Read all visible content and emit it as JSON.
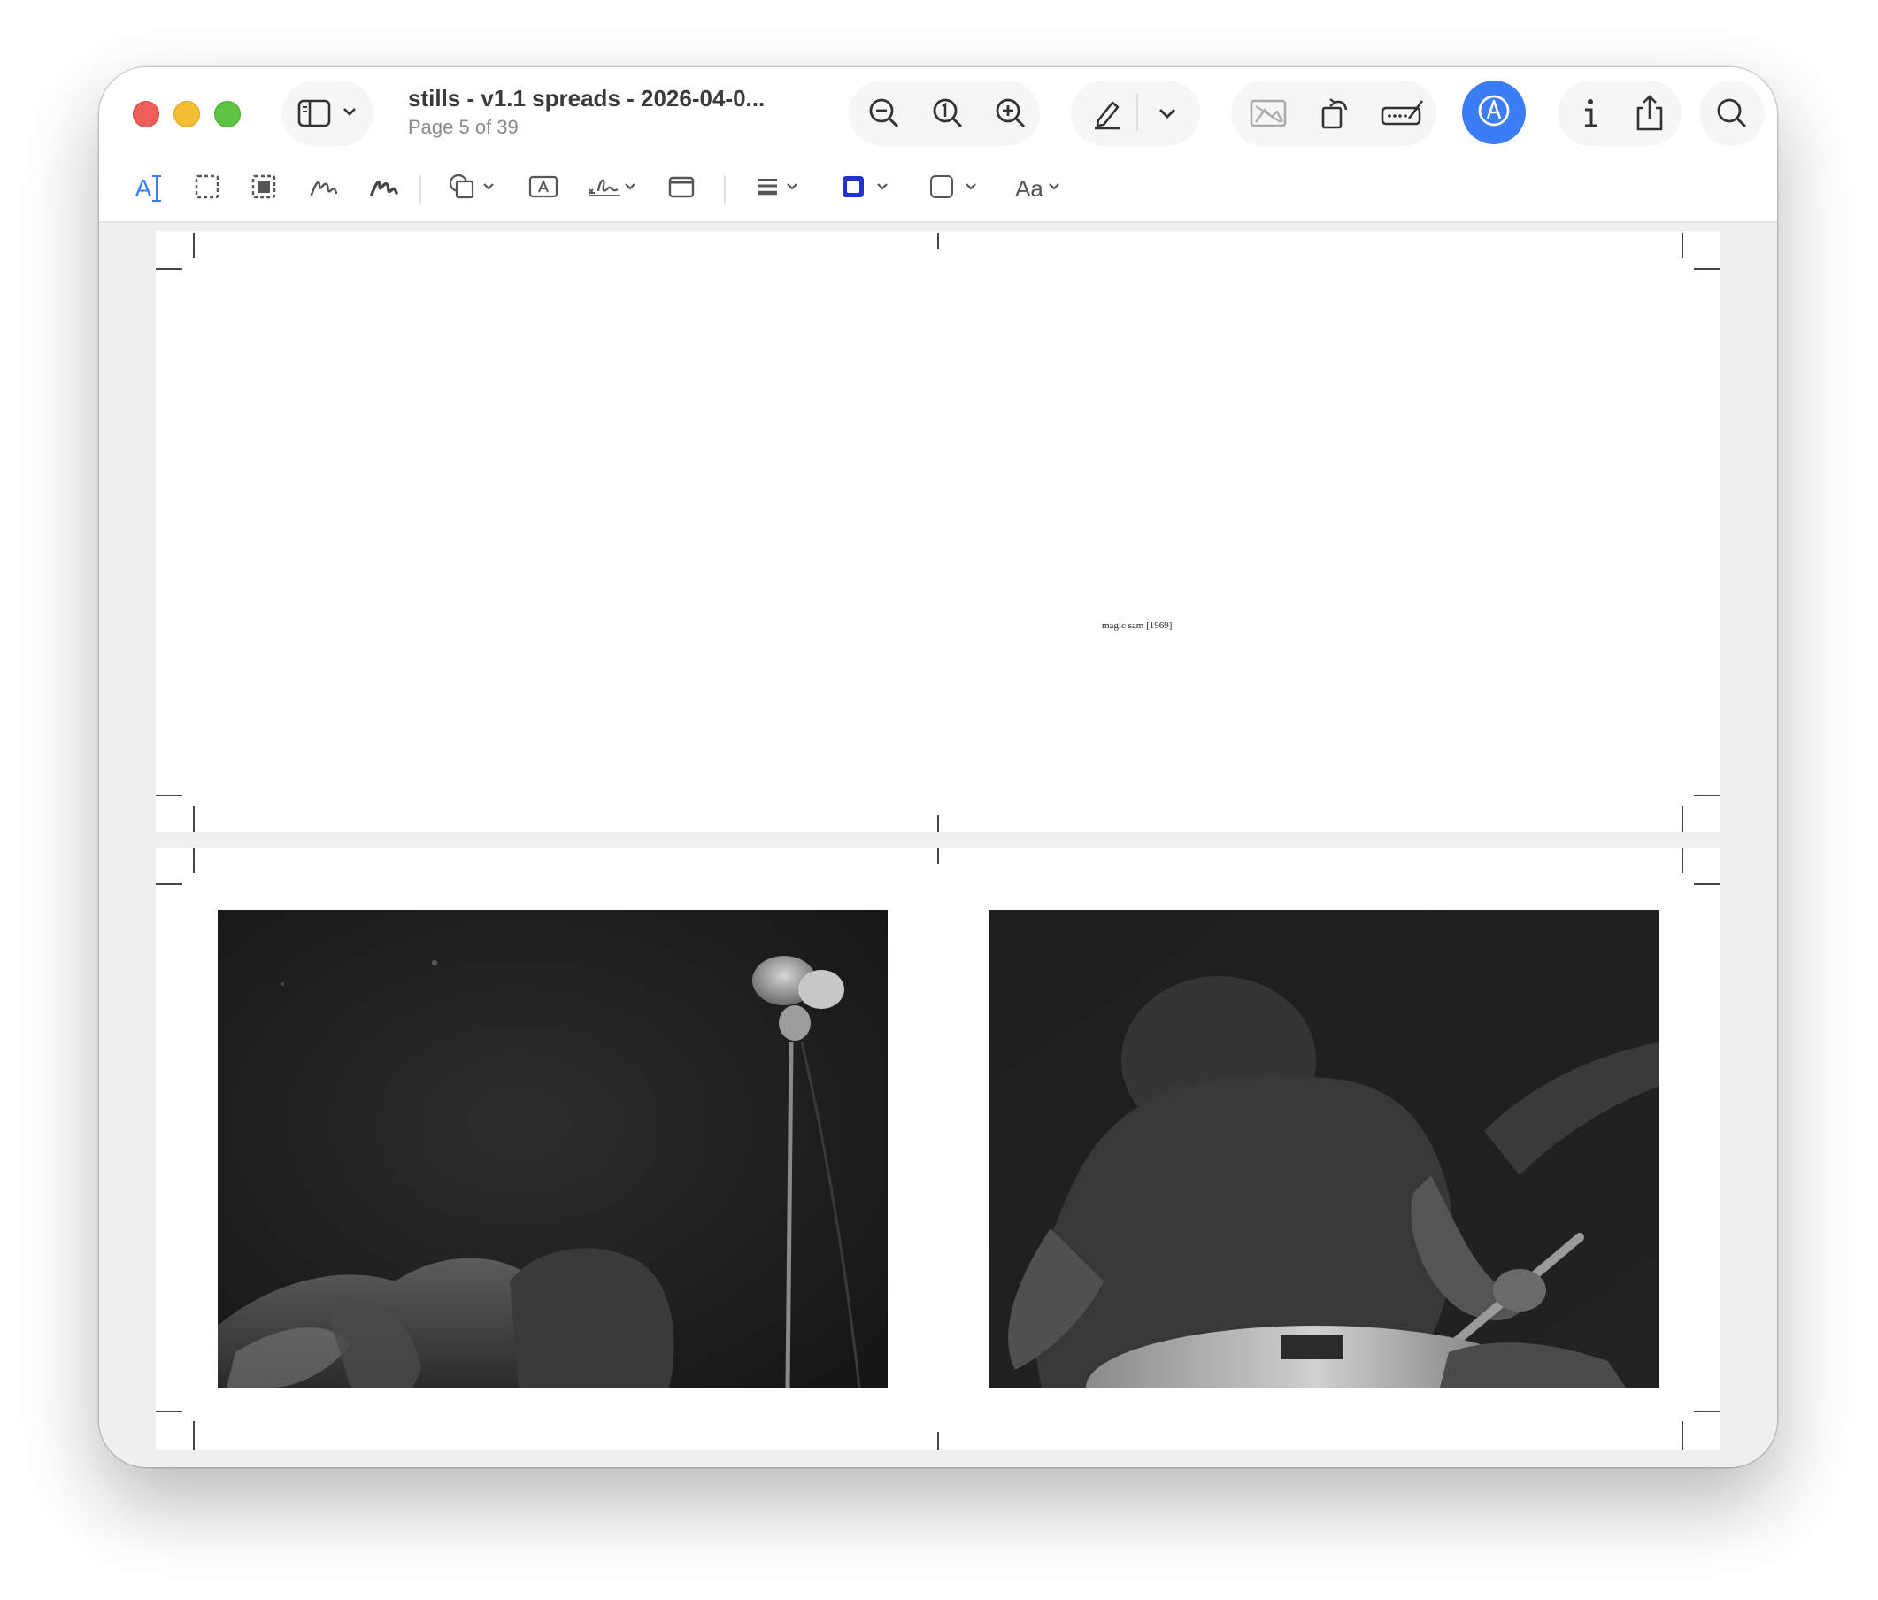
{
  "window": {
    "title": "stills - v1.1 spreads - 2026-04-0...",
    "subtitle": "Page 5 of 39"
  },
  "toolbar": {
    "sidebar_icon": "sidebar-icon",
    "zoom_out_icon": "zoom-out-icon",
    "actual_size_icon": "actual-size-icon",
    "zoom_in_icon": "zoom-in-icon",
    "highlight_icon": "pen-icon",
    "crop_icon": "image-icon",
    "rotate_icon": "rotate-icon",
    "redact_icon": "redact-icon",
    "markup_icon": "markup-icon",
    "info_icon": "info-icon",
    "share_icon": "share-icon",
    "search_icon": "search-icon",
    "accent_color": "#3a7df6"
  },
  "markup_toolbar": {
    "text_select_label": "A",
    "text_style_label": "Aa",
    "accent_color": "#3a7df6",
    "border_color": "#2233cc"
  },
  "pages": [
    {
      "caption": "magic sam [1969]"
    },
    {
      "photos": [
        "photo-left",
        "photo-right"
      ]
    }
  ]
}
